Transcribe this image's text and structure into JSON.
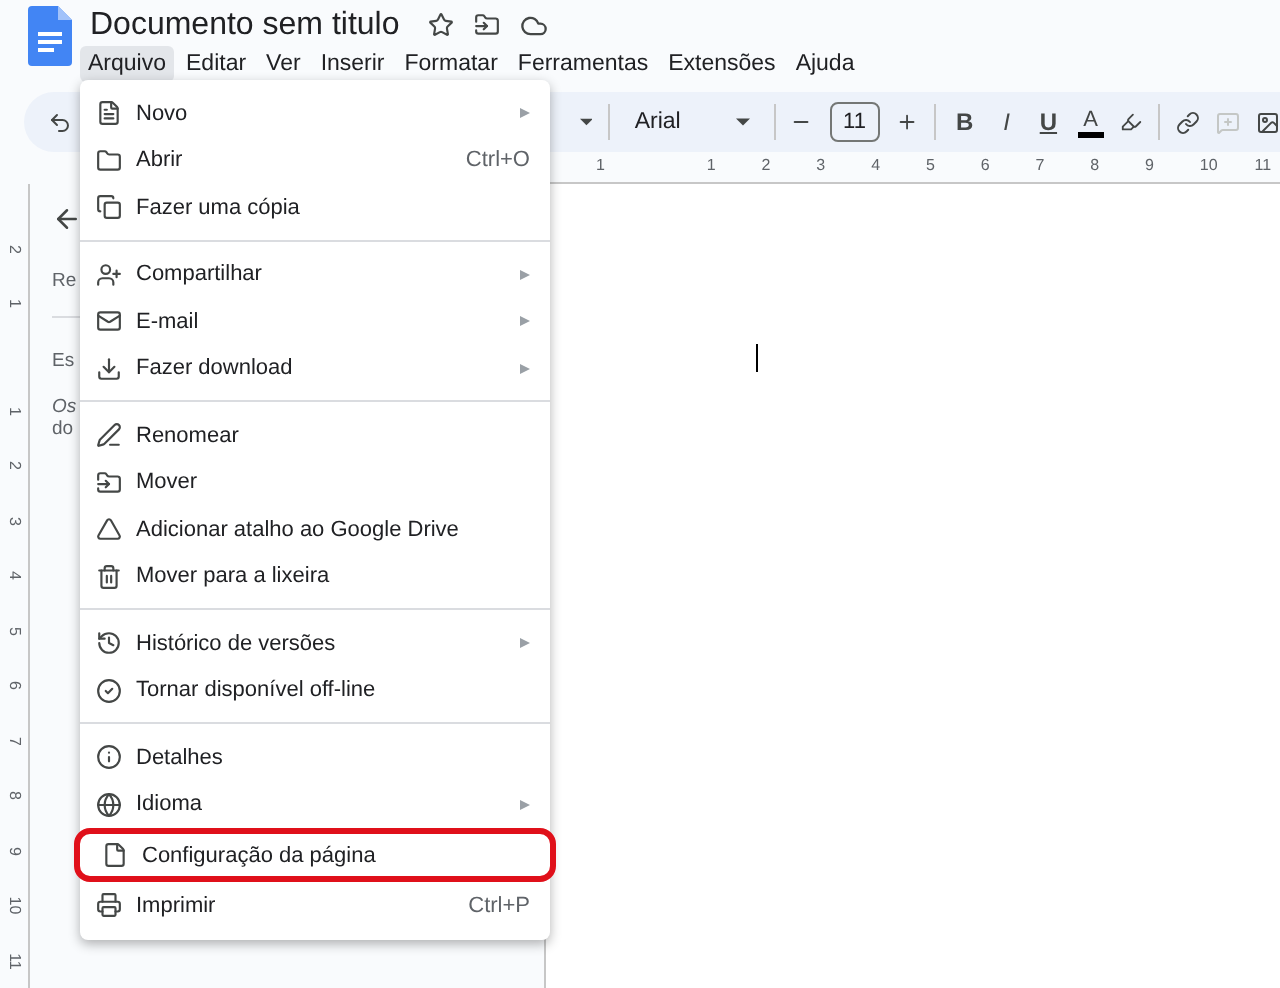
{
  "document": {
    "title": "Documento sem titulo"
  },
  "menubar": [
    {
      "label": "Arquivo",
      "selected": true
    },
    {
      "label": "Editar",
      "selected": false
    },
    {
      "label": "Ver",
      "selected": false
    },
    {
      "label": "Inserir",
      "selected": false
    },
    {
      "label": "Formatar",
      "selected": false
    },
    {
      "label": "Ferramentas",
      "selected": false
    },
    {
      "label": "Extensões",
      "selected": false
    },
    {
      "label": "Ajuda",
      "selected": false
    }
  ],
  "toolbar": {
    "font": "Arial",
    "font_size": "11",
    "bold": "B",
    "italic": "I",
    "underline": "U",
    "text_color": "A",
    "comment_disabled": true
  },
  "horizontal_ruler": [
    "1",
    "1",
    "2",
    "3",
    "4",
    "5",
    "6",
    "7",
    "8",
    "9",
    "10",
    "11"
  ],
  "vertical_ruler": [
    "2",
    "1",
    "1",
    "2",
    "3",
    "4",
    "5",
    "6",
    "7",
    "8",
    "9",
    "10",
    "11"
  ],
  "outline_panel": {
    "texts": [
      "Re",
      "Es",
      "Os",
      "do"
    ]
  },
  "file_menu": {
    "groups": [
      [
        {
          "label": "Novo",
          "submenu": true,
          "highlighted": false
        },
        {
          "label": "Abrir",
          "shortcut": "Ctrl+O",
          "submenu": false,
          "highlighted": false
        },
        {
          "label": "Fazer uma cópia",
          "submenu": false,
          "highlighted": false
        }
      ],
      [
        {
          "label": "Compartilhar",
          "submenu": true,
          "highlighted": false
        },
        {
          "label": "E-mail",
          "submenu": true,
          "highlighted": false
        },
        {
          "label": "Fazer download",
          "submenu": true,
          "highlighted": false
        }
      ],
      [
        {
          "label": "Renomear",
          "submenu": false,
          "highlighted": false
        },
        {
          "label": "Mover",
          "submenu": false,
          "highlighted": false
        },
        {
          "label": "Adicionar atalho ao Google Drive",
          "submenu": false,
          "highlighted": false
        },
        {
          "label": "Mover para a lixeira",
          "submenu": false,
          "highlighted": false
        }
      ],
      [
        {
          "label": "Histórico de versões",
          "submenu": true,
          "highlighted": false
        },
        {
          "label": "Tornar disponível off-line",
          "submenu": false,
          "highlighted": false
        }
      ],
      [
        {
          "label": "Detalhes",
          "submenu": false,
          "highlighted": false
        },
        {
          "label": "Idioma",
          "submenu": true,
          "highlighted": false
        },
        {
          "label": "Configuração da página",
          "submenu": false,
          "highlighted": true
        },
        {
          "label": "Imprimir",
          "shortcut": "Ctrl+P",
          "submenu": false,
          "highlighted": false
        }
      ]
    ]
  }
}
